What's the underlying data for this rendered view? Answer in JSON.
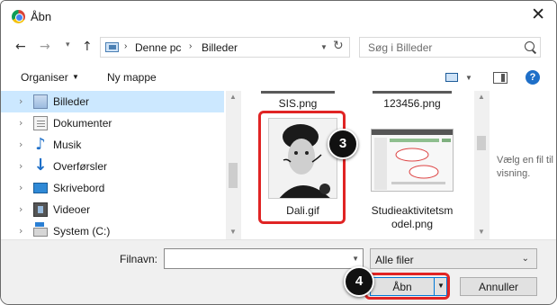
{
  "window": {
    "title": "Åbn",
    "close_glyph": "✕"
  },
  "nav": {
    "back_glyph": "←",
    "forward_glyph": "→",
    "recent_glyph": "▾",
    "up_glyph": "↑",
    "breadcrumb": [
      "Denne pc",
      "Billeder"
    ],
    "breadcrumb_sep": "›",
    "refresh_glyph": "↻",
    "search_placeholder": "Søg i Billeder"
  },
  "toolbar": {
    "organise_label": "Organiser",
    "new_folder_label": "Ny mappe",
    "help_label": "?"
  },
  "sidebar": {
    "items": [
      {
        "label": "Billeder",
        "icon": "pictures-icon",
        "selected": true
      },
      {
        "label": "Dokumenter",
        "icon": "documents-icon",
        "selected": false
      },
      {
        "label": "Musik",
        "icon": "music-icon",
        "selected": false
      },
      {
        "label": "Overførsler",
        "icon": "downloads-icon",
        "selected": false
      },
      {
        "label": "Skrivebord",
        "icon": "desktop-icon",
        "selected": false
      },
      {
        "label": "Videoer",
        "icon": "videos-icon",
        "selected": false
      },
      {
        "label": "System (C:)",
        "icon": "drive-icon",
        "selected": false
      }
    ]
  },
  "files": [
    {
      "name": "SIS.png"
    },
    {
      "name": "123456.png"
    },
    {
      "name": "Dali.gif",
      "highlighted": true
    },
    {
      "name": "Studieaktivitetsmodel.png",
      "name_lines": [
        "Studieaktivitetsm",
        "odel.png"
      ]
    }
  ],
  "preview": {
    "empty_text": "Vælg en fil til visning."
  },
  "bottom": {
    "filename_label": "Filnavn:",
    "filename_value": "",
    "filter_value": "Alle filer",
    "open_label": "Åbn",
    "cancel_label": "Annuller"
  },
  "annotations": {
    "step_open_file": "3",
    "step_click_open": "4"
  },
  "colors": {
    "highlight": "#e02424",
    "accent": "#0078d7",
    "selected_bg": "#cce8ff"
  }
}
